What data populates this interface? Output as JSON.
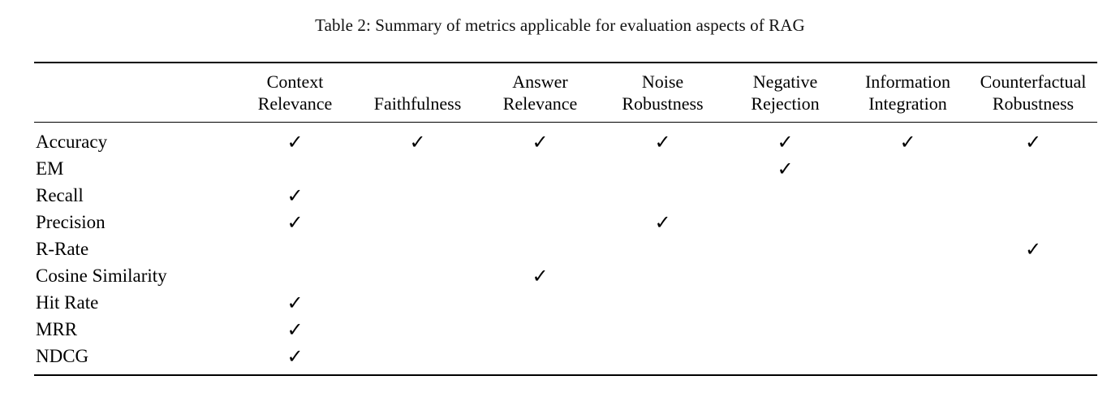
{
  "caption": {
    "label": "Table 2:",
    "text": "Table 2: Summary of metrics applicable for evaluation aspects of RAG"
  },
  "table": {
    "row_header_blank": "",
    "columns": [
      {
        "id": "context-relevance",
        "line1": "Context",
        "line2": "Relevance"
      },
      {
        "id": "faithfulness",
        "line1": "",
        "line2": "Faithfulness"
      },
      {
        "id": "answer-relevance",
        "line1": "Answer",
        "line2": "Relevance"
      },
      {
        "id": "noise-robustness",
        "line1": "Noise",
        "line2": "Robustness"
      },
      {
        "id": "negative-rejection",
        "line1": "Negative",
        "line2": "Rejection"
      },
      {
        "id": "information-integration",
        "line1": "Information",
        "line2": "Integration"
      },
      {
        "id": "counterfactual-robustness",
        "line1": "Counterfactual",
        "line2": "Robustness"
      }
    ],
    "check_glyph": "✓",
    "rows": [
      {
        "id": "accuracy",
        "label": "Accuracy",
        "marks": [
          true,
          true,
          true,
          true,
          true,
          true,
          true
        ]
      },
      {
        "id": "em",
        "label": "EM",
        "marks": [
          false,
          false,
          false,
          false,
          true,
          false,
          false
        ]
      },
      {
        "id": "recall",
        "label": "Recall",
        "marks": [
          true,
          false,
          false,
          false,
          false,
          false,
          false
        ]
      },
      {
        "id": "precision",
        "label": "Precision",
        "marks": [
          true,
          false,
          false,
          true,
          false,
          false,
          false
        ]
      },
      {
        "id": "r-rate",
        "label": "R-Rate",
        "marks": [
          false,
          false,
          false,
          false,
          false,
          false,
          true
        ]
      },
      {
        "id": "cosine-similarity",
        "label": "Cosine Similarity",
        "marks": [
          false,
          false,
          true,
          false,
          false,
          false,
          false
        ]
      },
      {
        "id": "hit-rate",
        "label": "Hit Rate",
        "marks": [
          true,
          false,
          false,
          false,
          false,
          false,
          false
        ]
      },
      {
        "id": "mrr",
        "label": "MRR",
        "marks": [
          true,
          false,
          false,
          false,
          false,
          false,
          false
        ]
      },
      {
        "id": "ndcg",
        "label": "NDCG",
        "marks": [
          true,
          false,
          false,
          false,
          false,
          false,
          false
        ]
      }
    ]
  },
  "colors": {
    "rule": "#000000",
    "text": "#000000",
    "background": "#ffffff"
  }
}
